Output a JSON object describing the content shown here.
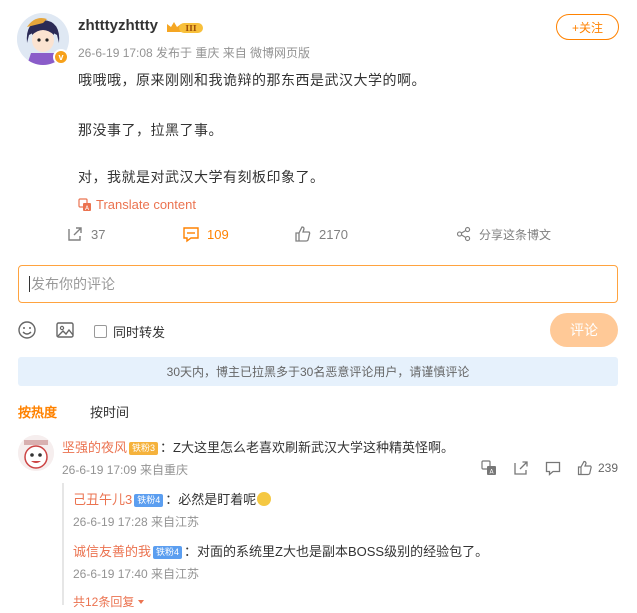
{
  "post": {
    "username": "zhtttyzhttty",
    "vip_level": "III",
    "verified_mark": "v",
    "meta": "26-6-19 17:08  发布于 重庆  来自 微博网页版",
    "follow_label": "+关注",
    "paragraphs": [
      "哦哦哦，原来刚刚和我诡辩的那东西是武汉大学的啊。",
      "那没事了，拉黑了事。",
      "对，我就是对武汉大学有刻板印象了。"
    ],
    "translate_label": "Translate content",
    "repost_count": "37",
    "comment_count": "109",
    "like_count": "2170",
    "share_label": "分享这条博文"
  },
  "composer": {
    "placeholder": "发布你的评论",
    "repost_label": "同时转发",
    "submit_label": "评论"
  },
  "notice": "30天内，博主已拉黑多于30名恶意评论用户，请谨慎评论",
  "sort": {
    "hot": "按热度",
    "time": "按时间"
  },
  "comments": [
    {
      "name": "坚强的夜风",
      "badge": "铁粉3",
      "text": "：Z大这里怎么老喜欢刷新武汉大学这种精英怪啊。",
      "time": "26-6-19 17:09 来自重庆",
      "likes": "239",
      "replies": [
        {
          "name": "己丑午儿3",
          "badge": "铁粉4",
          "text": "：必然是盯着呢",
          "time": "26-6-19 17:28 来自江苏"
        },
        {
          "name": "诚信友善的我",
          "badge": "铁粉4",
          "text": "：对面的系统里Z大也是副本BOSS级别的经验包了。",
          "time": "26-6-19 17:40 来自江苏"
        }
      ],
      "more_label": "共12条回复"
    }
  ],
  "colors": {
    "accent": "#ff8200",
    "link": "#eb7350",
    "notice_bg": "#e6f1fc"
  }
}
